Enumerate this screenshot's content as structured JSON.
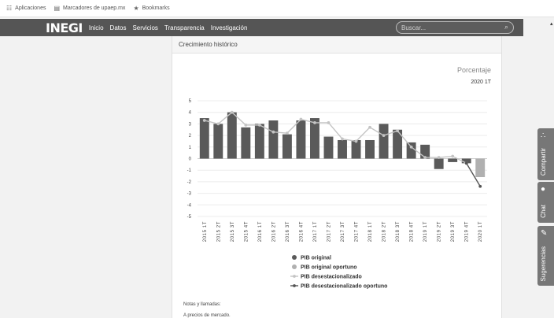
{
  "bookmarks": {
    "items": [
      {
        "label": "Aplicaciones",
        "icon": "apps-grid-icon"
      },
      {
        "label": "Marcadores de upaep.mx",
        "icon": "bookmark-page-icon"
      },
      {
        "label": "Bookmarks",
        "icon": "star-icon"
      }
    ]
  },
  "nav": {
    "logo": "INEGI",
    "links": [
      "Inicio",
      "Datos",
      "Servicios",
      "Transparencia",
      "Investigación"
    ],
    "search_placeholder": "Buscar..."
  },
  "card": {
    "header": "Crecimiento histórico",
    "unit_label": "Porcentaje",
    "period_label": "2020 1T",
    "notes_title": "Notas y llamadas:",
    "notes_line": "A precios de mercado."
  },
  "side_tabs": [
    {
      "label": "Compartir",
      "icon": "share-icon"
    },
    {
      "label": "Chat",
      "icon": "chat-icon"
    },
    {
      "label": "Sugerencias",
      "icon": "edit-icon"
    }
  ],
  "colors": {
    "bar_original": "#5a5a5a",
    "bar_oportuno": "#b0b0b0",
    "line_desest": "#c4c4c4",
    "line_desest_oportuno": "#555555",
    "nav_bg": "#555555"
  },
  "chart_data": {
    "type": "bar",
    "title": "",
    "ylim": [
      -5,
      5
    ],
    "yticks": [
      5,
      4,
      3,
      2,
      1,
      0,
      -1,
      -2,
      -3,
      -4,
      -5
    ],
    "grid": true,
    "legend_position": "bottom",
    "categories": [
      "2015 1T",
      "2015 2T",
      "2015 3T",
      "2015 4T",
      "2016 1T",
      "2016 2T",
      "2016 3T",
      "2016 4T",
      "2017 1T",
      "2017 2T",
      "2017 3T",
      "2017 4T",
      "2018 1T",
      "2018 2T",
      "2018 3T",
      "2018 4T",
      "2019 1T",
      "2019 2T",
      "2019 3T",
      "2019 4T",
      "2020 1T"
    ],
    "series": [
      {
        "name": "PIB original",
        "kind": "bar",
        "values": [
          3.5,
          3.0,
          4.0,
          2.7,
          3.0,
          3.3,
          2.1,
          3.3,
          3.5,
          1.9,
          1.6,
          1.6,
          1.6,
          3.0,
          2.5,
          1.4,
          1.2,
          -0.9,
          -0.3,
          -0.4,
          null
        ]
      },
      {
        "name": "PIB original oportuno",
        "kind": "bar",
        "values": [
          null,
          null,
          null,
          null,
          null,
          null,
          null,
          null,
          null,
          null,
          null,
          null,
          null,
          null,
          null,
          null,
          null,
          null,
          null,
          null,
          -1.6
        ]
      },
      {
        "name": "PIB desestacionalizado",
        "kind": "line",
        "values": [
          3.3,
          3.0,
          4.0,
          2.9,
          2.9,
          2.3,
          2.2,
          3.4,
          3.1,
          3.1,
          1.7,
          1.5,
          2.7,
          2.0,
          2.4,
          1.0,
          0.1,
          0.1,
          0.2,
          -0.4,
          null
        ]
      },
      {
        "name": "PIB desestacionalizado oportuno",
        "kind": "line",
        "values": [
          null,
          null,
          null,
          null,
          null,
          null,
          null,
          null,
          null,
          null,
          null,
          null,
          null,
          null,
          null,
          null,
          null,
          null,
          null,
          -0.4,
          -2.4
        ]
      }
    ]
  }
}
